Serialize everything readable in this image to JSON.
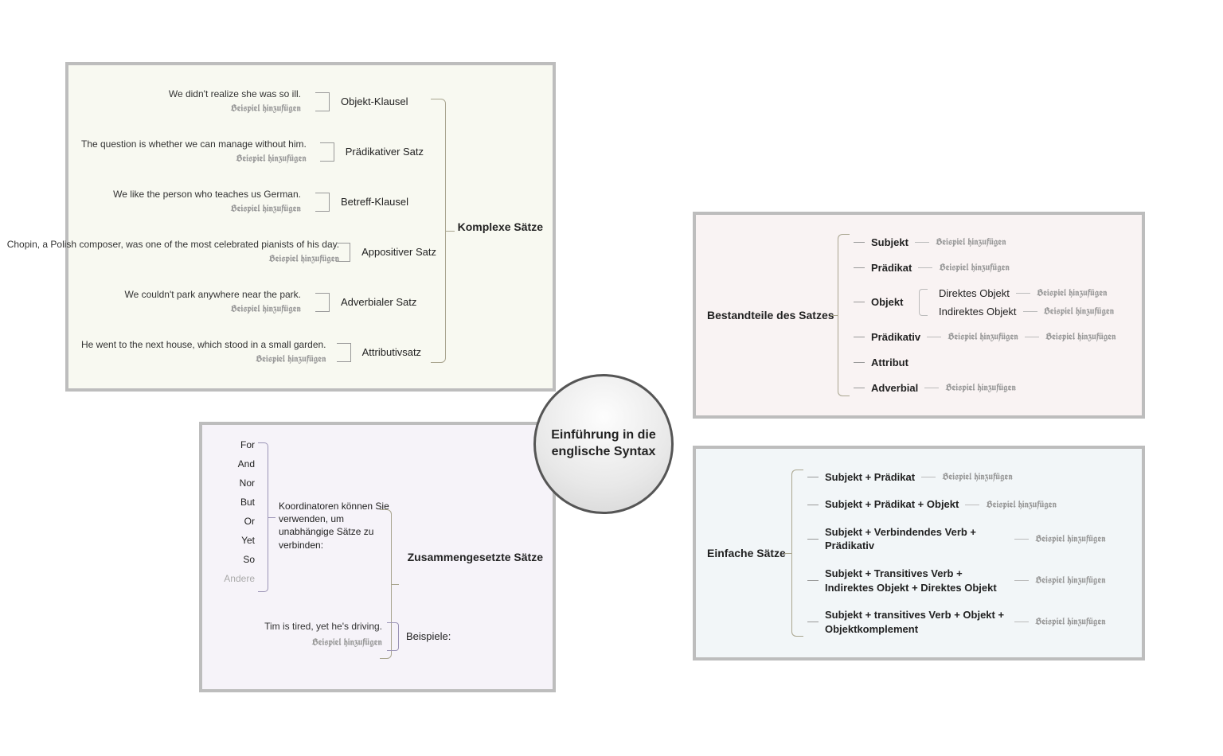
{
  "center": {
    "title": "Einführung in die englische Syntax"
  },
  "addExampleLabel": "Beispiel hinzufügen",
  "otherLabel": "Andere",
  "panels": {
    "complex": {
      "title": "Komplexe Sätze",
      "items": [
        {
          "name": "Objekt-Klausel",
          "example": "We didn't realize she was so ill."
        },
        {
          "name": "Prädikativer Satz",
          "example": "The question is whether we can manage without him."
        },
        {
          "name": "Betreff-Klausel",
          "example": "We like the person who teaches us German."
        },
        {
          "name": "Appositiver Satz",
          "example": "Chopin, a Polish composer, was one of the most celebrated pianists of his day."
        },
        {
          "name": "Adverbialer Satz",
          "example": "We couldn't park anywhere near the park."
        },
        {
          "name": "Attributivsatz",
          "example": "He went to the next house, which stood in a small garden."
        }
      ]
    },
    "compound": {
      "title": "Zusammengesetzte Sätze",
      "coordinatorsLabel": "Koordinatoren können Sie verwenden, um unabhängige Sätze zu verbinden:",
      "coordinators": [
        "For",
        "And",
        "Nor",
        "But",
        "Or",
        "Yet",
        "So"
      ],
      "examplesLabel": "Beispiele:",
      "example": "Tim is tired, yet he's driving."
    },
    "members": {
      "title": "Bestandteile des Satzes",
      "rows": [
        {
          "name": "Subjekt",
          "addExample": true
        },
        {
          "name": "Prädikat",
          "addExample": true
        },
        {
          "name": "Objekt",
          "children": [
            {
              "name": "Direktes Objekt",
              "addExample": true
            },
            {
              "name": "Indirektes Objekt",
              "addExample": true
            }
          ]
        },
        {
          "name": "Prädikativ",
          "addExample": true,
          "addExample2": true
        },
        {
          "name": "Attribut"
        },
        {
          "name": "Adverbial",
          "addExample": true
        }
      ]
    },
    "simple": {
      "title": "Einfache Sätze",
      "rows": [
        {
          "name": "Subjekt + Prädikat"
        },
        {
          "name": "Subjekt + Prädikat + Objekt"
        },
        {
          "name": "Subjekt + Verbindendes Verb + Prädikativ"
        },
        {
          "name": "Subjekt + Transitives Verb + Indirektes Objekt + Direktes Objekt"
        },
        {
          "name": "Subjekt + transitives Verb + Objekt + Objektkomplement"
        }
      ]
    }
  }
}
